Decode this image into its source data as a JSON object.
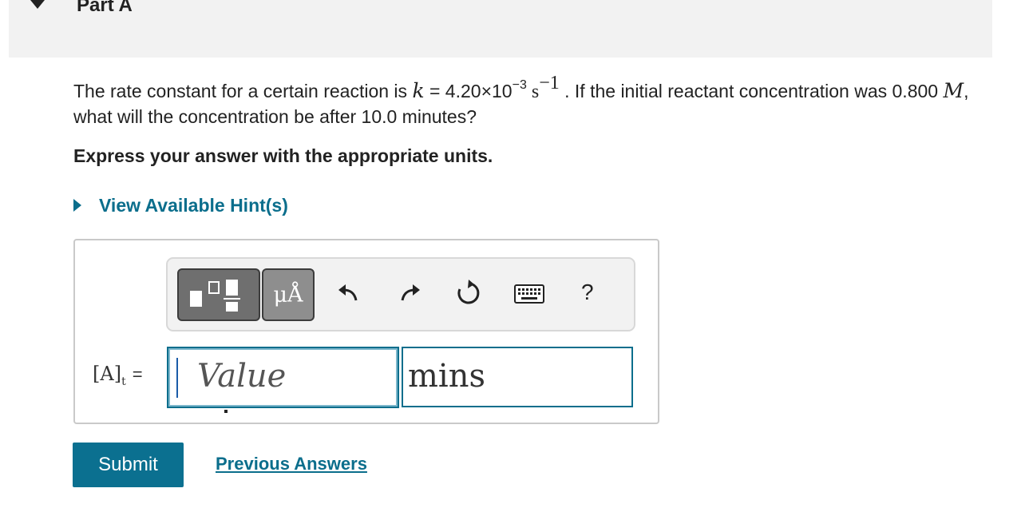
{
  "part": {
    "title": "Part A"
  },
  "question": {
    "text1": "The rate constant for a certain reaction is ",
    "k_symbol": "k",
    "text2": " = 4.20×10",
    "exp1": "−3",
    "unit_s": " s",
    "exp2": "−1",
    "text3": " . If the initial reactant concentration was 0.800 ",
    "M_symbol": "M",
    "text4": ", what will the concentration be after 10.0 minutes?"
  },
  "instructions": "Express your answer with the appropriate units.",
  "hint": {
    "label": "View Available Hint(s)"
  },
  "toolbar": {
    "units_label": "μÅ",
    "help_label": "?",
    "icons": [
      "templates-icon",
      "units-icon",
      "undo-icon",
      "redo-icon",
      "reset-icon",
      "keyboard-icon",
      "help-icon"
    ]
  },
  "answer": {
    "lhs": "[A]",
    "lhs_sub": "t",
    "equals": "=",
    "value_placeholder": "Value",
    "unit_value": "mins"
  },
  "actions": {
    "submit_label": "Submit",
    "previous_answers_label": "Previous Answers"
  },
  "colors": {
    "accent": "#0b7090",
    "link": "#0b6e8c",
    "header_bg": "#f2f2f2"
  }
}
